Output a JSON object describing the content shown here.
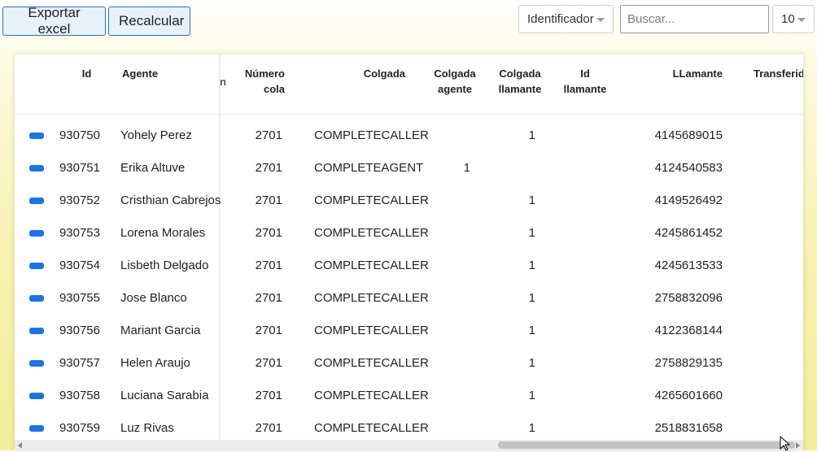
{
  "toolbar": {
    "export_label": "Exportar excel",
    "recalc_label": "Recalcular",
    "filter_selected": "Identificador",
    "search_placeholder": "Buscar...",
    "page_size": "10"
  },
  "table": {
    "headers": {
      "id": "Id",
      "agente": "Agente",
      "clipped": "n",
      "numero_cola_1": "Número",
      "numero_cola_2": "cola",
      "colgada": "Colgada",
      "colgada_agente_1": "Colgada",
      "colgada_agente_2": "agente",
      "colgada_llamante_1": "Colgada",
      "colgada_llamante_2": "llamante",
      "id_llamante_1": "Id",
      "id_llamante_2": "llamante",
      "llamante": "LLamante",
      "transferido": "Transferido"
    },
    "rows": [
      {
        "id": "930750",
        "agente": "Yohely Perez",
        "cola": "2701",
        "colgada": "COMPLETECALLER",
        "colgada_agente": "",
        "colgada_llamante": "1",
        "llamante": "4145689015"
      },
      {
        "id": "930751",
        "agente": "Erika Altuve",
        "cola": "2701",
        "colgada": "COMPLETEAGENT",
        "colgada_agente": "1",
        "colgada_llamante": "",
        "llamante": "4124540583"
      },
      {
        "id": "930752",
        "agente": "Cristhian Cabrejos",
        "cola": "2701",
        "colgada": "COMPLETECALLER",
        "colgada_agente": "",
        "colgada_llamante": "1",
        "llamante": "4149526492"
      },
      {
        "id": "930753",
        "agente": "Lorena Morales",
        "cola": "2701",
        "colgada": "COMPLETECALLER",
        "colgada_agente": "",
        "colgada_llamante": "1",
        "llamante": "4245861452"
      },
      {
        "id": "930754",
        "agente": "Lisbeth Delgado",
        "cola": "2701",
        "colgada": "COMPLETECALLER",
        "colgada_agente": "",
        "colgada_llamante": "1",
        "llamante": "4245613533"
      },
      {
        "id": "930755",
        "agente": "Jose Blanco",
        "cola": "2701",
        "colgada": "COMPLETECALLER",
        "colgada_agente": "",
        "colgada_llamante": "1",
        "llamante": "2758832096"
      },
      {
        "id": "930756",
        "agente": "Mariant Garcia",
        "cola": "2701",
        "colgada": "COMPLETECALLER",
        "colgada_agente": "",
        "colgada_llamante": "1",
        "llamante": "4122368144"
      },
      {
        "id": "930757",
        "agente": "Helen Araujo",
        "cola": "2701",
        "colgada": "COMPLETECALLER",
        "colgada_agente": "",
        "colgada_llamante": "1",
        "llamante": "2758829135"
      },
      {
        "id": "930758",
        "agente": "Luciana Sarabia",
        "cola": "2701",
        "colgada": "COMPLETECALLER",
        "colgada_agente": "",
        "colgada_llamante": "1",
        "llamante": "4265601660"
      },
      {
        "id": "930759",
        "agente": "Luz Rivas",
        "cola": "2701",
        "colgada": "COMPLETECALLER",
        "colgada_agente": "",
        "colgada_llamante": "1",
        "llamante": "2518831658"
      }
    ]
  },
  "colors": {
    "accent": "#1a73e8",
    "button_border": "#2f6fb3",
    "background": "#f4ee9a"
  },
  "icons": {
    "row_action": "expand-pill-icon",
    "dropdown": "chevron-down-icon",
    "cursor": "mouse-pointer-icon"
  }
}
